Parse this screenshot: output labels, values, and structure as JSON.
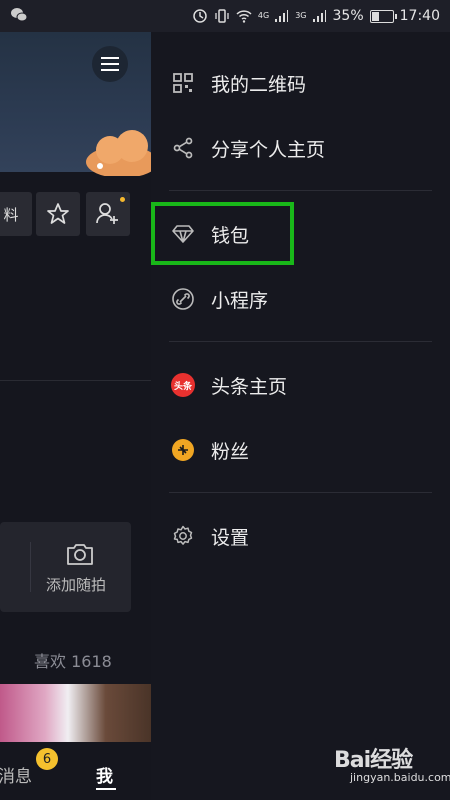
{
  "status_bar": {
    "battery_percent": "35%",
    "battery_level": 0.35,
    "time": "17:40",
    "net_1": "4G",
    "net_2": "3G"
  },
  "background": {
    "edit_label_fragment": "料",
    "camera_caption": "添加随拍",
    "likes_text": "喜欢 1618",
    "tabs": {
      "messages_label": "消息",
      "messages_badge": "6",
      "me_label": "我"
    }
  },
  "drawer": {
    "items": [
      {
        "label": "我的二维码",
        "icon": "qr-code-icon"
      },
      {
        "label": "分享个人主页",
        "icon": "share-icon"
      },
      {
        "label": "钱包",
        "icon": "diamond-icon"
      },
      {
        "label": "小程序",
        "icon": "link-icon"
      },
      {
        "label": "头条主页",
        "icon": "toutiao-icon",
        "icon_text": "头条"
      },
      {
        "label": "粉丝",
        "icon": "fans-icon"
      },
      {
        "label": "设置",
        "icon": "gear-icon"
      }
    ],
    "highlight_color": "#19b819"
  },
  "watermark": {
    "brand_text": "Bai经验",
    "url": "jingyan.baidu.com"
  }
}
